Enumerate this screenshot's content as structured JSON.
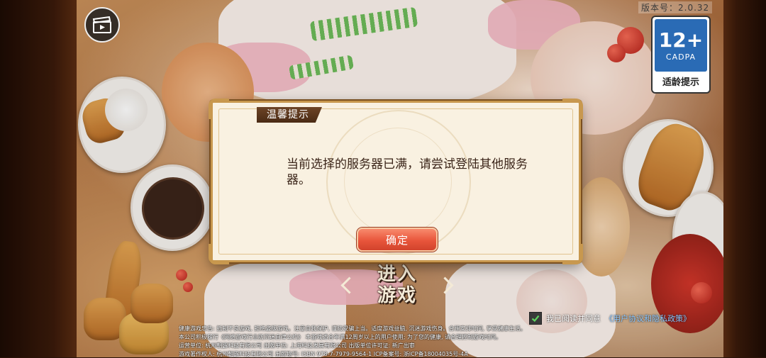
{
  "version": {
    "label": "版本号：2.0.32"
  },
  "age_rating": {
    "number": "12+",
    "org": "CADPA",
    "label": "适龄提示"
  },
  "dialog": {
    "title": "温馨提示",
    "message": "当前选择的服务器已满，请尝试登陆其他服务器。",
    "ok_label": "确定"
  },
  "enter_game": {
    "line1": "进入",
    "line2": "游戏"
  },
  "agreement": {
    "prefix": "我已阅读并同意",
    "link": "《用户协议和隐私政策》",
    "checked": true
  },
  "legal": {
    "line1": "健康游戏忠告: 抵制不良游戏, 拒绝盗版游戏。注意自我保护, 谨防受骗上当。适度游戏益脑, 沉迷游戏伤身。合理安排时间, 享受健康生活。",
    "line2": "本公司积极履行《网络游戏行业防沉迷自律公约》 本游戏适合年满12周岁以上的用户使用; 为了您的健康, 请合理控制游戏时间。",
    "line3": "运营单位: 杭州朝露科技有限公司   出版单位: 上海科技发展有限公司   出版单位许可证: 新广出审",
    "line4": "游戏著作权人: 杭州朝露科技有限公司   出版物号: ISBN 978-7-7979-9564-1   ICP备案号: 浙ICP备18004035号-4A"
  },
  "icons": {
    "video": "video-clapper-icon",
    "check": "checkmark-icon"
  },
  "colors": {
    "dialog_bg": "#f9f1e1",
    "dialog_border": "#c8984e",
    "title_bar": "#5a341b",
    "ok_button": "#e8553b",
    "age_blue": "#2a6bb5",
    "link": "#8ec8ff"
  }
}
